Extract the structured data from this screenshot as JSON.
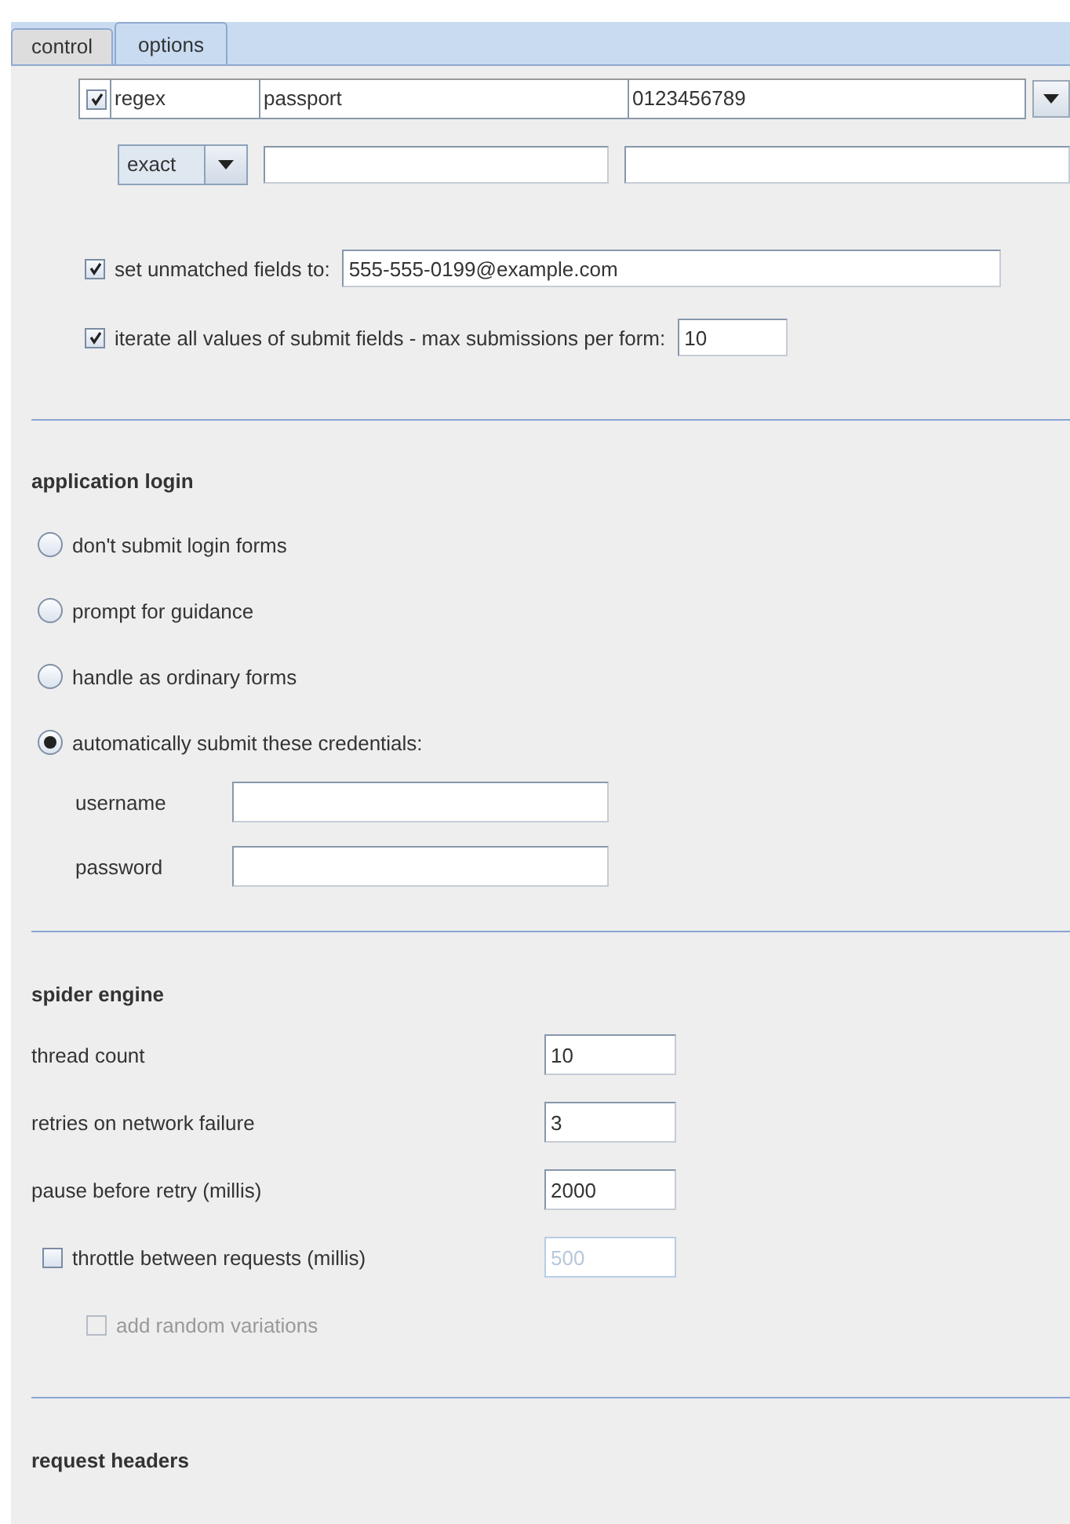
{
  "tabs": [
    {
      "label": "control",
      "selected": false
    },
    {
      "label": "options",
      "selected": true
    }
  ],
  "match_row": {
    "checked": true,
    "cells": [
      "regex",
      "passport",
      "0123456789"
    ]
  },
  "new_row": {
    "mode": "exact"
  },
  "options": [
    {
      "label": "set unmatched fields to:",
      "checked": true,
      "value": "555-555-0199@example.com",
      "wide": true
    },
    {
      "label": "iterate all values of submit fields - max submissions per form:",
      "checked": true,
      "value": "10",
      "wide": false
    }
  ],
  "application_login": {
    "title": "application login",
    "choices": [
      {
        "label": "don't submit login forms",
        "selected": false
      },
      {
        "label": "prompt for guidance",
        "selected": false
      },
      {
        "label": "handle as ordinary forms",
        "selected": false
      },
      {
        "label": "automatically submit these credentials:",
        "selected": true
      }
    ],
    "credentials": [
      {
        "label": "username"
      },
      {
        "label": "password"
      }
    ]
  },
  "spider_engine": {
    "title": "spider engine",
    "settings": [
      {
        "kind": "number",
        "label": "thread count",
        "value": "10"
      },
      {
        "kind": "number",
        "label": "retries on network failure",
        "value": "3"
      },
      {
        "kind": "number",
        "label": "pause before retry (millis)",
        "value": "2000"
      },
      {
        "kind": "checkbox",
        "label": "throttle between requests (millis)",
        "checked": false,
        "value": "500",
        "field_disabled": true
      },
      {
        "kind": "sub_checkbox",
        "label": "add random variations",
        "checked": false,
        "disabled": true
      }
    ]
  },
  "request_headers": {
    "title": "request headers"
  }
}
